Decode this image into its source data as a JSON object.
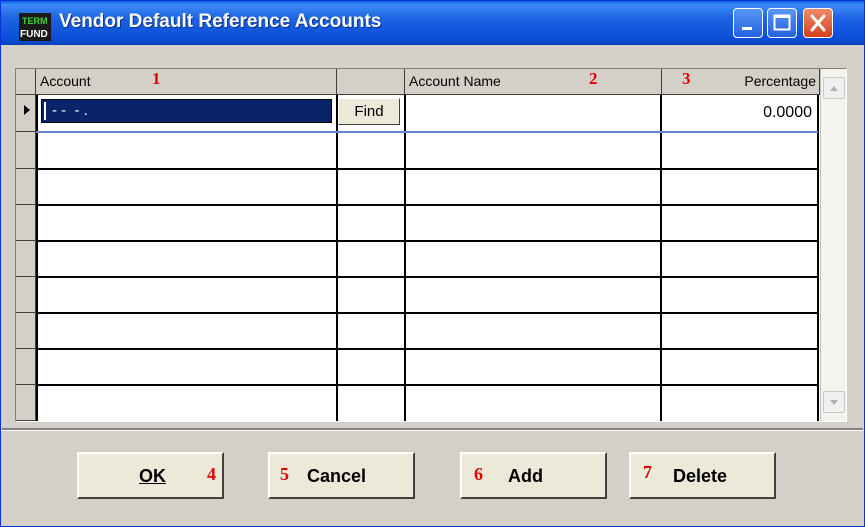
{
  "window": {
    "title": "Vendor Default Reference Accounts",
    "icon": "fund-icon",
    "icon_text_top": "TERM",
    "icon_text_bottom": "FUND"
  },
  "grid": {
    "columns": [
      {
        "label": "Account",
        "callout": "1"
      },
      {
        "label": ""
      },
      {
        "label": "Account Name",
        "callout": "2"
      },
      {
        "label": "Percentage",
        "callout": "3"
      }
    ],
    "row1": {
      "account_value": "- -  - .",
      "find_label": "Find",
      "account_name": "",
      "percentage": "0.0000"
    }
  },
  "buttons": {
    "ok": {
      "label": "OK",
      "callout": "4"
    },
    "cancel": {
      "label": "Cancel",
      "callout": "5"
    },
    "add": {
      "label": "Add",
      "callout": "6"
    },
    "delete": {
      "label": "Delete",
      "callout": "7"
    }
  },
  "colors": {
    "callout": "#e00000",
    "selection": "#0a246a",
    "titlebar": "#0a4fd8"
  }
}
